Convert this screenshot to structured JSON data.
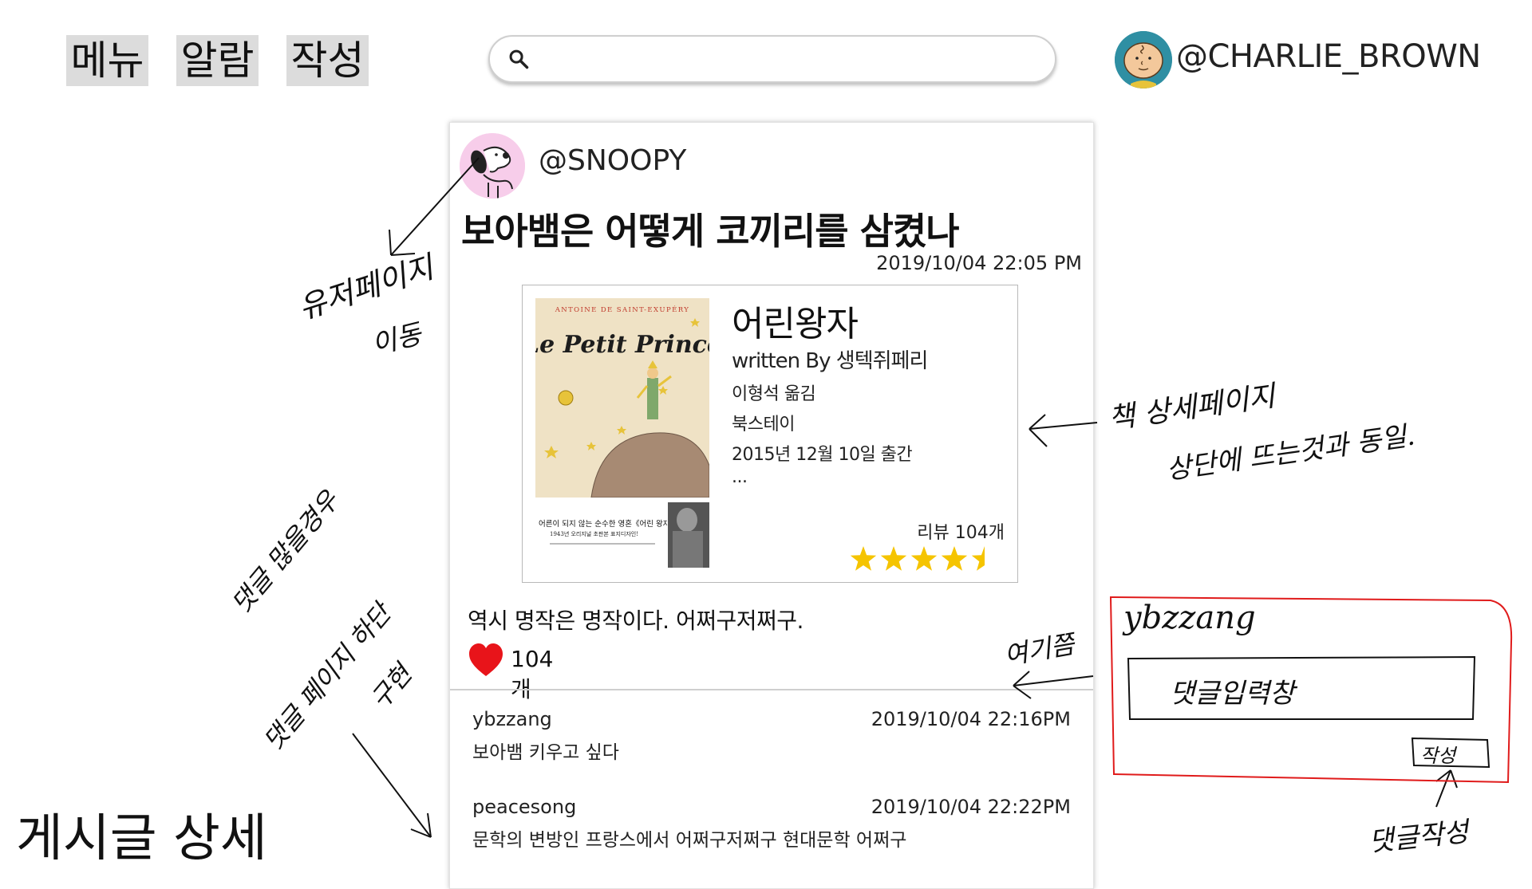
{
  "nav": {
    "menu_label": "메뉴",
    "alarm_label": "알람",
    "write_label": "작성"
  },
  "search": {
    "placeholder": "",
    "value": ""
  },
  "current_user": {
    "handle": "@CHARLIE_BROWN"
  },
  "post": {
    "author_handle": "@SNOOPY",
    "title": "보아뱀은 어떻게 코끼리를 삼켰나",
    "date": "2019/10/04 22:05 PM",
    "body": "역시 명작은 명작이다. 어쩌구저쩌구.",
    "like_count": "104개"
  },
  "book": {
    "cover_author_line": "ANTOINE DE SAINT-EXUPÉRY",
    "cover_title": "Le Petit Prince",
    "cover_tagline": "어른이 되지 않는 순수한 영혼《어린 왕자》",
    "cover_subtagline": "1943년 오리지널 초판본 표지디자인!",
    "title": "어린왕자",
    "author": "written By 생텍쥐페리",
    "translator": "이형석 옮김",
    "publisher": "북스테이",
    "pub_date": "2015년 12월 10일 출간",
    "more": "...",
    "review_count": "리뷰 104개",
    "rating_stars": 4.5,
    "rating_max": 5,
    "star_color": "#f5c400"
  },
  "comments": [
    {
      "user": "ybzzang",
      "date": "2019/10/04 22:16PM",
      "text": "보아뱀 키우고 싶다"
    },
    {
      "user": "peacesong",
      "date": "2019/10/04 22:22PM",
      "text": "문학의 변방인 프랑스에서 어쩌구저쩌구 현대문학 어쩌구"
    }
  ],
  "page_label": "게시글 상세",
  "annotations": {
    "user_page": "유저페이지",
    "user_page_2": "이동",
    "book_detail": "책 상세페이지",
    "book_detail_2": "상단에 뜨는것과 동일.",
    "comments_many": "댓글 많을경우",
    "comments_many_2": "댓글 페이지 하단",
    "comments_many_3": "구현",
    "here": "여기쯤",
    "comment_user": "ybzzang",
    "comment_input": "댓글입력창",
    "comment_write_btn": "작성",
    "comment_write": "댓글작성"
  },
  "colors": {
    "heart": "#e8141a",
    "annotation_box": "#e01b1b",
    "nav_bg": "#dcdcdc"
  }
}
